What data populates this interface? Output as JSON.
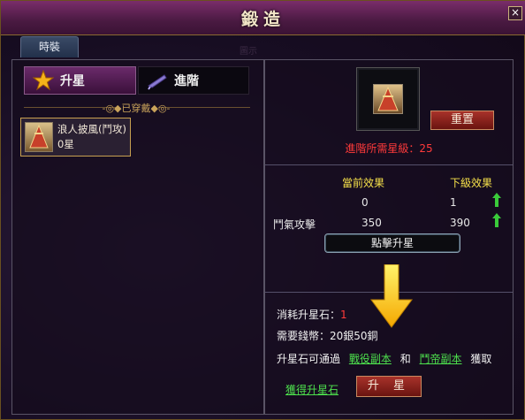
{
  "window": {
    "title": "鍛造",
    "close_symbol": "×"
  },
  "tabs": [
    {
      "label": "時裝",
      "active": true
    }
  ],
  "ghost_text": "圖示",
  "left": {
    "mode_tabs": [
      {
        "label": "升星",
        "active": true,
        "icon": "star-icon"
      },
      {
        "label": "進階",
        "active": false,
        "icon": "feather-icon"
      }
    ],
    "section_title": "-◎◆已穿戴◆◎-",
    "items": [
      {
        "name": "浪人披風(鬥攻)",
        "stars": "0星",
        "icon": "cloak-icon"
      }
    ]
  },
  "right": {
    "reset_label": "重置",
    "requirement_label": "進階所需星級：",
    "requirement_value": "25",
    "col_current": "當前效果",
    "col_next": "下級效果",
    "rows": [
      {
        "label": "",
        "current": "0",
        "next": "1"
      },
      {
        "label": "鬥氣攻擊",
        "current": "350",
        "next": "390"
      }
    ],
    "click_upgrade_label": "點擊升星",
    "cost_stone_label": "消耗升星石：",
    "cost_stone_value": "1",
    "cost_money_label": "需要錢幣：",
    "cost_money_value": "20銀50銅",
    "source_prefix": "升星石可通過",
    "source_link1": "戰役副本",
    "source_mid": "和",
    "source_link2": "鬥帝副本",
    "source_suffix": "獲取",
    "get_stone_link": "獲得升星石",
    "upgrade_button": "升 星"
  },
  "colors": {
    "accent_red": "#ff3a3a",
    "link_green": "#4de04d",
    "header_yellow": "#f5e04a",
    "frame_gold": "#c8a050"
  }
}
